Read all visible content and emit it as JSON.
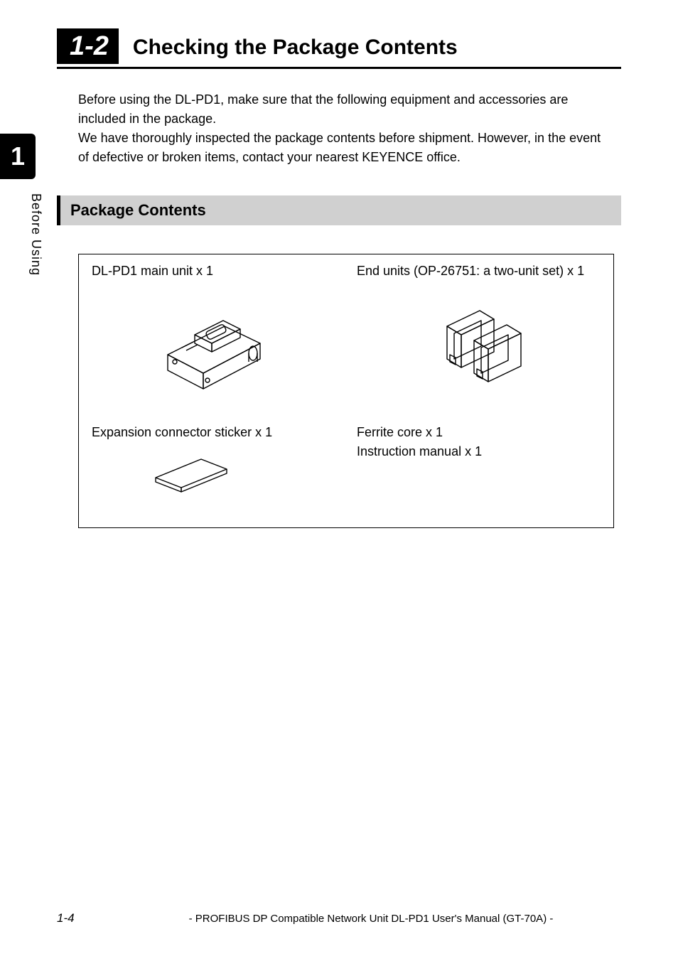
{
  "header": {
    "section_number": "1-2",
    "section_title": "Checking the Package Contents"
  },
  "chapter_tab": "1",
  "side_text": "Before Using",
  "intro": {
    "paragraph1": "Before using the DL-PD1, make sure that the following equipment and accessories are included in the package.",
    "paragraph2": "We have thoroughly inspected the package contents before shipment. However, in the event of defective or broken items, contact your nearest KEYENCE office."
  },
  "subsection_heading": "Package Contents",
  "contents": {
    "item1_label": "DL-PD1 main unit x 1",
    "item2_label": "End units (OP-26751: a two-unit set) x 1",
    "item3_label": "Expansion connector sticker x 1",
    "item4_line1": "Ferrite core x 1",
    "item4_line2": "Instruction manual x 1"
  },
  "footer": {
    "page_number": "1-4",
    "doc_title": "- PROFIBUS DP Compatible Network Unit DL-PD1 User's Manual (GT-70A) -"
  }
}
